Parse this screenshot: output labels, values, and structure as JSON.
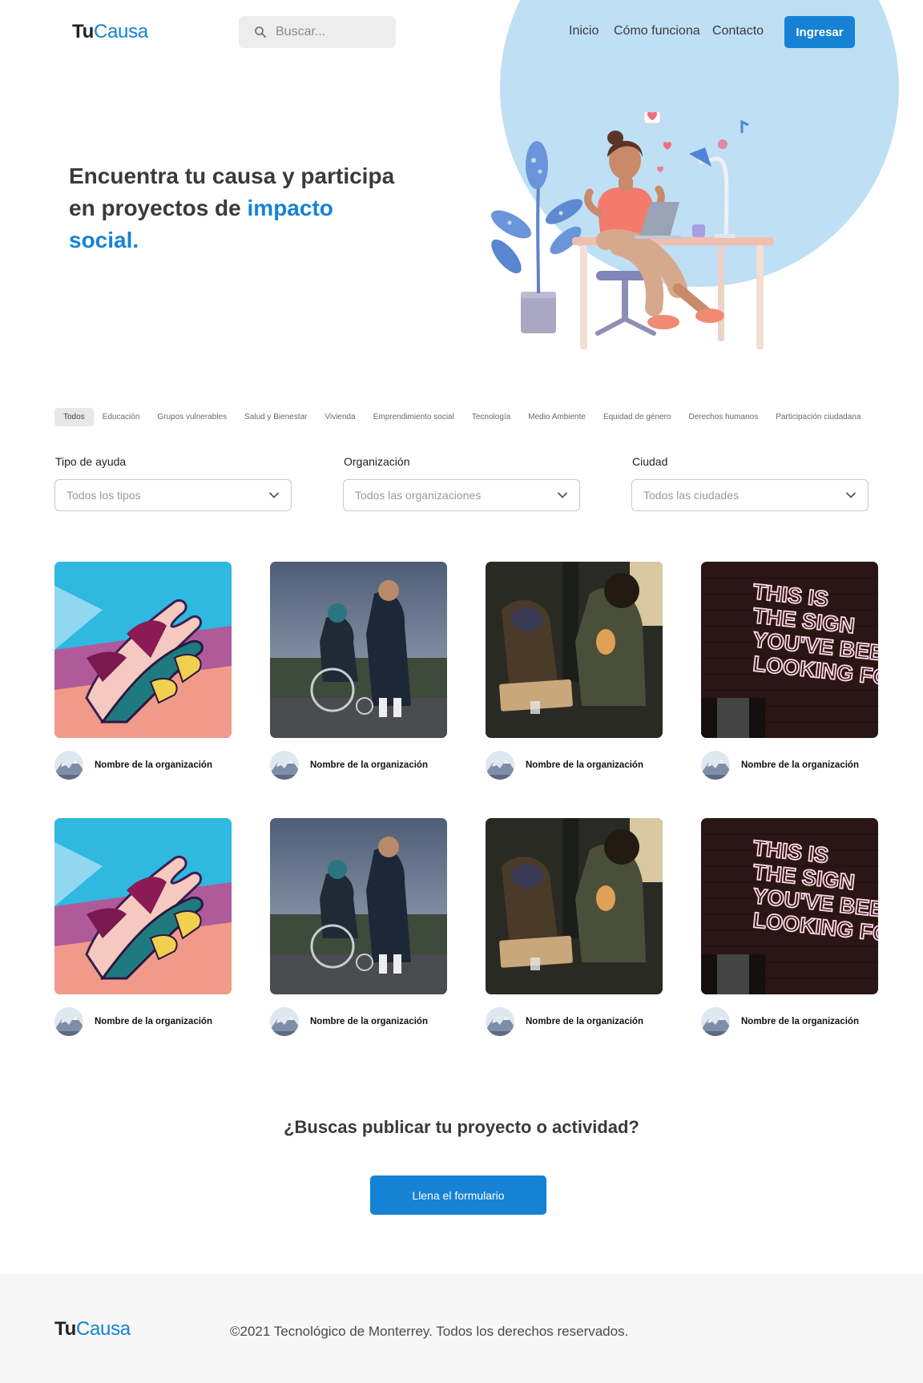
{
  "brand": {
    "tu": "Tu",
    "causa": "Causa"
  },
  "search": {
    "placeholder": "Buscar..."
  },
  "nav": {
    "inicio": "Inicio",
    "como_funciona": "Cómo funciona",
    "contacto": "Contacto",
    "login": "Ingresar"
  },
  "hero": {
    "title_part1": "Encuentra tu causa y participa en proyectos de ",
    "title_highlight": "impacto social."
  },
  "categories": [
    "Todos",
    "Educación",
    "Grupos vulnerables",
    "Salud y Bienestar",
    "Vivienda",
    "Emprendimiento social",
    "Tecnología",
    "Medio Ambiente",
    "Equidad de género",
    "Derechos humanos",
    "Participación ciudadana"
  ],
  "active_category": "Todos",
  "filters": {
    "tipo": {
      "label": "Tipo de ayuda",
      "value": "Todos los tipos"
    },
    "organizacion": {
      "label": "Organización",
      "value": "Todos las organizaciones"
    },
    "ciudad": {
      "label": "Ciudad",
      "value": "Todos las ciudades"
    }
  },
  "cards": [
    {
      "image": "hands-mural",
      "org_name": "Nombre de la organización"
    },
    {
      "image": "wheelchair-photo",
      "org_name": "Nombre de la organización"
    },
    {
      "image": "homeless-photo",
      "org_name": "Nombre de la organización"
    },
    {
      "image": "neon-sign",
      "org_name": "Nombre de la organización"
    },
    {
      "image": "hands-mural",
      "org_name": "Nombre de la organización"
    },
    {
      "image": "wheelchair-photo",
      "org_name": "Nombre de la organización"
    },
    {
      "image": "homeless-photo",
      "org_name": "Nombre de la organización"
    },
    {
      "image": "neon-sign",
      "org_name": "Nombre de la organización"
    }
  ],
  "neon_text": [
    "THIS IS",
    "THE SIGN",
    "YOU'VE BEEN",
    "LOOKING FOR"
  ],
  "cta": {
    "title": "¿Buscas publicar tu proyecto o actividad?",
    "button": "Llena el formulario"
  },
  "footer": {
    "copyright": "©2021 Tecnológico de Monterrey. Todos los derechos reservados."
  },
  "colors": {
    "accent": "#1682d4",
    "hero_circle": "#bfdff5",
    "footer_bg": "#f7f7f7"
  }
}
